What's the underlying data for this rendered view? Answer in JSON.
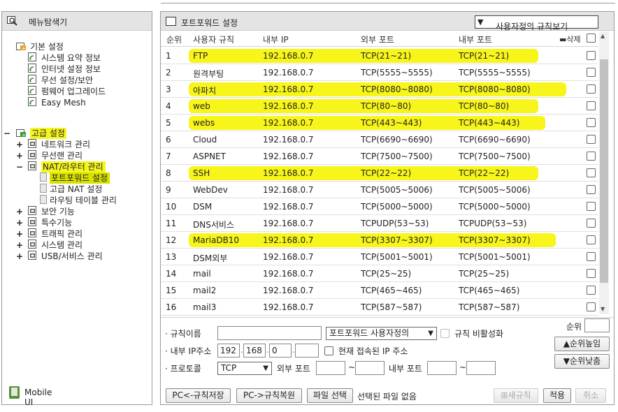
{
  "left": {
    "title": "메뉴탐색기",
    "basic": {
      "label": "기본 설정",
      "items": [
        "시스템 요약 정보",
        "인터넷 설정 정보",
        "무선 설정/보안",
        "펌웨어 업그레이드",
        "Easy Mesh"
      ]
    },
    "advanced": {
      "label": "고급 설정",
      "items": [
        {
          "label": "네트워크 관리",
          "toggle": "+"
        },
        {
          "label": "무선랜 관리",
          "toggle": "+"
        },
        {
          "label": "NAT/라우터 관리",
          "toggle": "−"
        },
        {
          "label": "포트포워드 설정",
          "toggle": ""
        },
        {
          "label": "고급 NAT 설정",
          "toggle": ""
        },
        {
          "label": "라우팅 테이블 관리",
          "toggle": ""
        },
        {
          "label": "보안 기능",
          "toggle": "+"
        },
        {
          "label": "특수기능",
          "toggle": "+"
        },
        {
          "label": "트래픽 관리",
          "toggle": "+"
        },
        {
          "label": "시스템 관리",
          "toggle": "+"
        },
        {
          "label": "USB/서비스 관리",
          "toggle": "+"
        }
      ]
    },
    "mobile": "Mobile UI"
  },
  "right": {
    "title": "포트포워드 설정",
    "view_select": "사용자정의 규칙보기",
    "columns": {
      "no": "순위",
      "name": "사용자 규칙",
      "inner_ip": "내부 IP",
      "outer_port": "외부 포트",
      "inner_port": "내부 포트",
      "delete": "삭제"
    },
    "rows": [
      {
        "no": "1",
        "name": "FTP",
        "ip": "192.168.0.7",
        "ext": "TCP(21~21)",
        "int": "TCP(21~21)"
      },
      {
        "no": "2",
        "name": "원격부팅",
        "ip": "192.168.0.7",
        "ext": "TCP(5555~5555)",
        "int": "TCP(5555~5555)"
      },
      {
        "no": "3",
        "name": "아파치",
        "ip": "192.168.0.7",
        "ext": "TCP(8080~8080)",
        "int": "TCP(8080~8080)"
      },
      {
        "no": "4",
        "name": "web",
        "ip": "192.168.0.7",
        "ext": "TCP(80~80)",
        "int": "TCP(80~80)"
      },
      {
        "no": "5",
        "name": "webs",
        "ip": "192.168.0.7",
        "ext": "TCP(443~443)",
        "int": "TCP(443~443)"
      },
      {
        "no": "6",
        "name": "Cloud",
        "ip": "192.168.0.7",
        "ext": "TCP(6690~6690)",
        "int": "TCP(6690~6690)"
      },
      {
        "no": "7",
        "name": "ASPNET",
        "ip": "192.168.0.7",
        "ext": "TCP(7500~7500)",
        "int": "TCP(7500~7500)"
      },
      {
        "no": "8",
        "name": "SSH",
        "ip": "192.168.0.7",
        "ext": "TCP(22~22)",
        "int": "TCP(22~22)"
      },
      {
        "no": "9",
        "name": "WebDev",
        "ip": "192.168.0.7",
        "ext": "TCP(5005~5006)",
        "int": "TCP(5005~5006)"
      },
      {
        "no": "10",
        "name": "DSM",
        "ip": "192.168.0.7",
        "ext": "TCP(5000~5000)",
        "int": "TCP(5000~5000)"
      },
      {
        "no": "11",
        "name": "DNS서비스",
        "ip": "192.168.0.7",
        "ext": "TCPUDP(53~53)",
        "int": "TCPUDP(53~53)"
      },
      {
        "no": "12",
        "name": "MariaDB10",
        "ip": "192.168.0.7",
        "ext": "TCP(3307~3307)",
        "int": "TCP(3307~3307)"
      },
      {
        "no": "13",
        "name": "DSM외부",
        "ip": "192.168.0.7",
        "ext": "TCP(5001~5001)",
        "int": "TCP(5001~5001)"
      },
      {
        "no": "14",
        "name": "mail",
        "ip": "192.168.0.7",
        "ext": "TCP(25~25)",
        "int": "TCP(25~25)"
      },
      {
        "no": "15",
        "name": "mail2",
        "ip": "192.168.0.7",
        "ext": "TCP(465~465)",
        "int": "TCP(465~465)"
      },
      {
        "no": "16",
        "name": "mail3",
        "ip": "192.168.0.7",
        "ext": "TCP(587~587)",
        "int": "TCP(587~587)"
      }
    ],
    "form": {
      "rule_name_label": "규칙이름",
      "rule_name_value": "",
      "rule_type_select": "포트포워드 사용자정의",
      "disable_label": "규칙 비활성화",
      "ip_label": "내부 IP주소",
      "ip1": "192",
      "ip2": "168",
      "ip3": "0",
      "ip4": "",
      "current_ip_label": "현재 접속된 IP 주소",
      "protocol_label": "프로토콜",
      "protocol_value": "TCP",
      "ext_port_label": "외부 포트",
      "int_port_label": "내부 포트",
      "tilde": "~",
      "priority_label": "순위",
      "priority_value": "",
      "up_button": "순위높임",
      "down_button": "순위낮춤",
      "save_button": "PC<-규칙저장",
      "restore_button": "PC->규칙복원",
      "file_button": "파일 선택",
      "file_status": "선택된 파일 없음",
      "new_button": "새규칙",
      "apply_button": "적용",
      "cancel_button": "취소"
    }
  }
}
